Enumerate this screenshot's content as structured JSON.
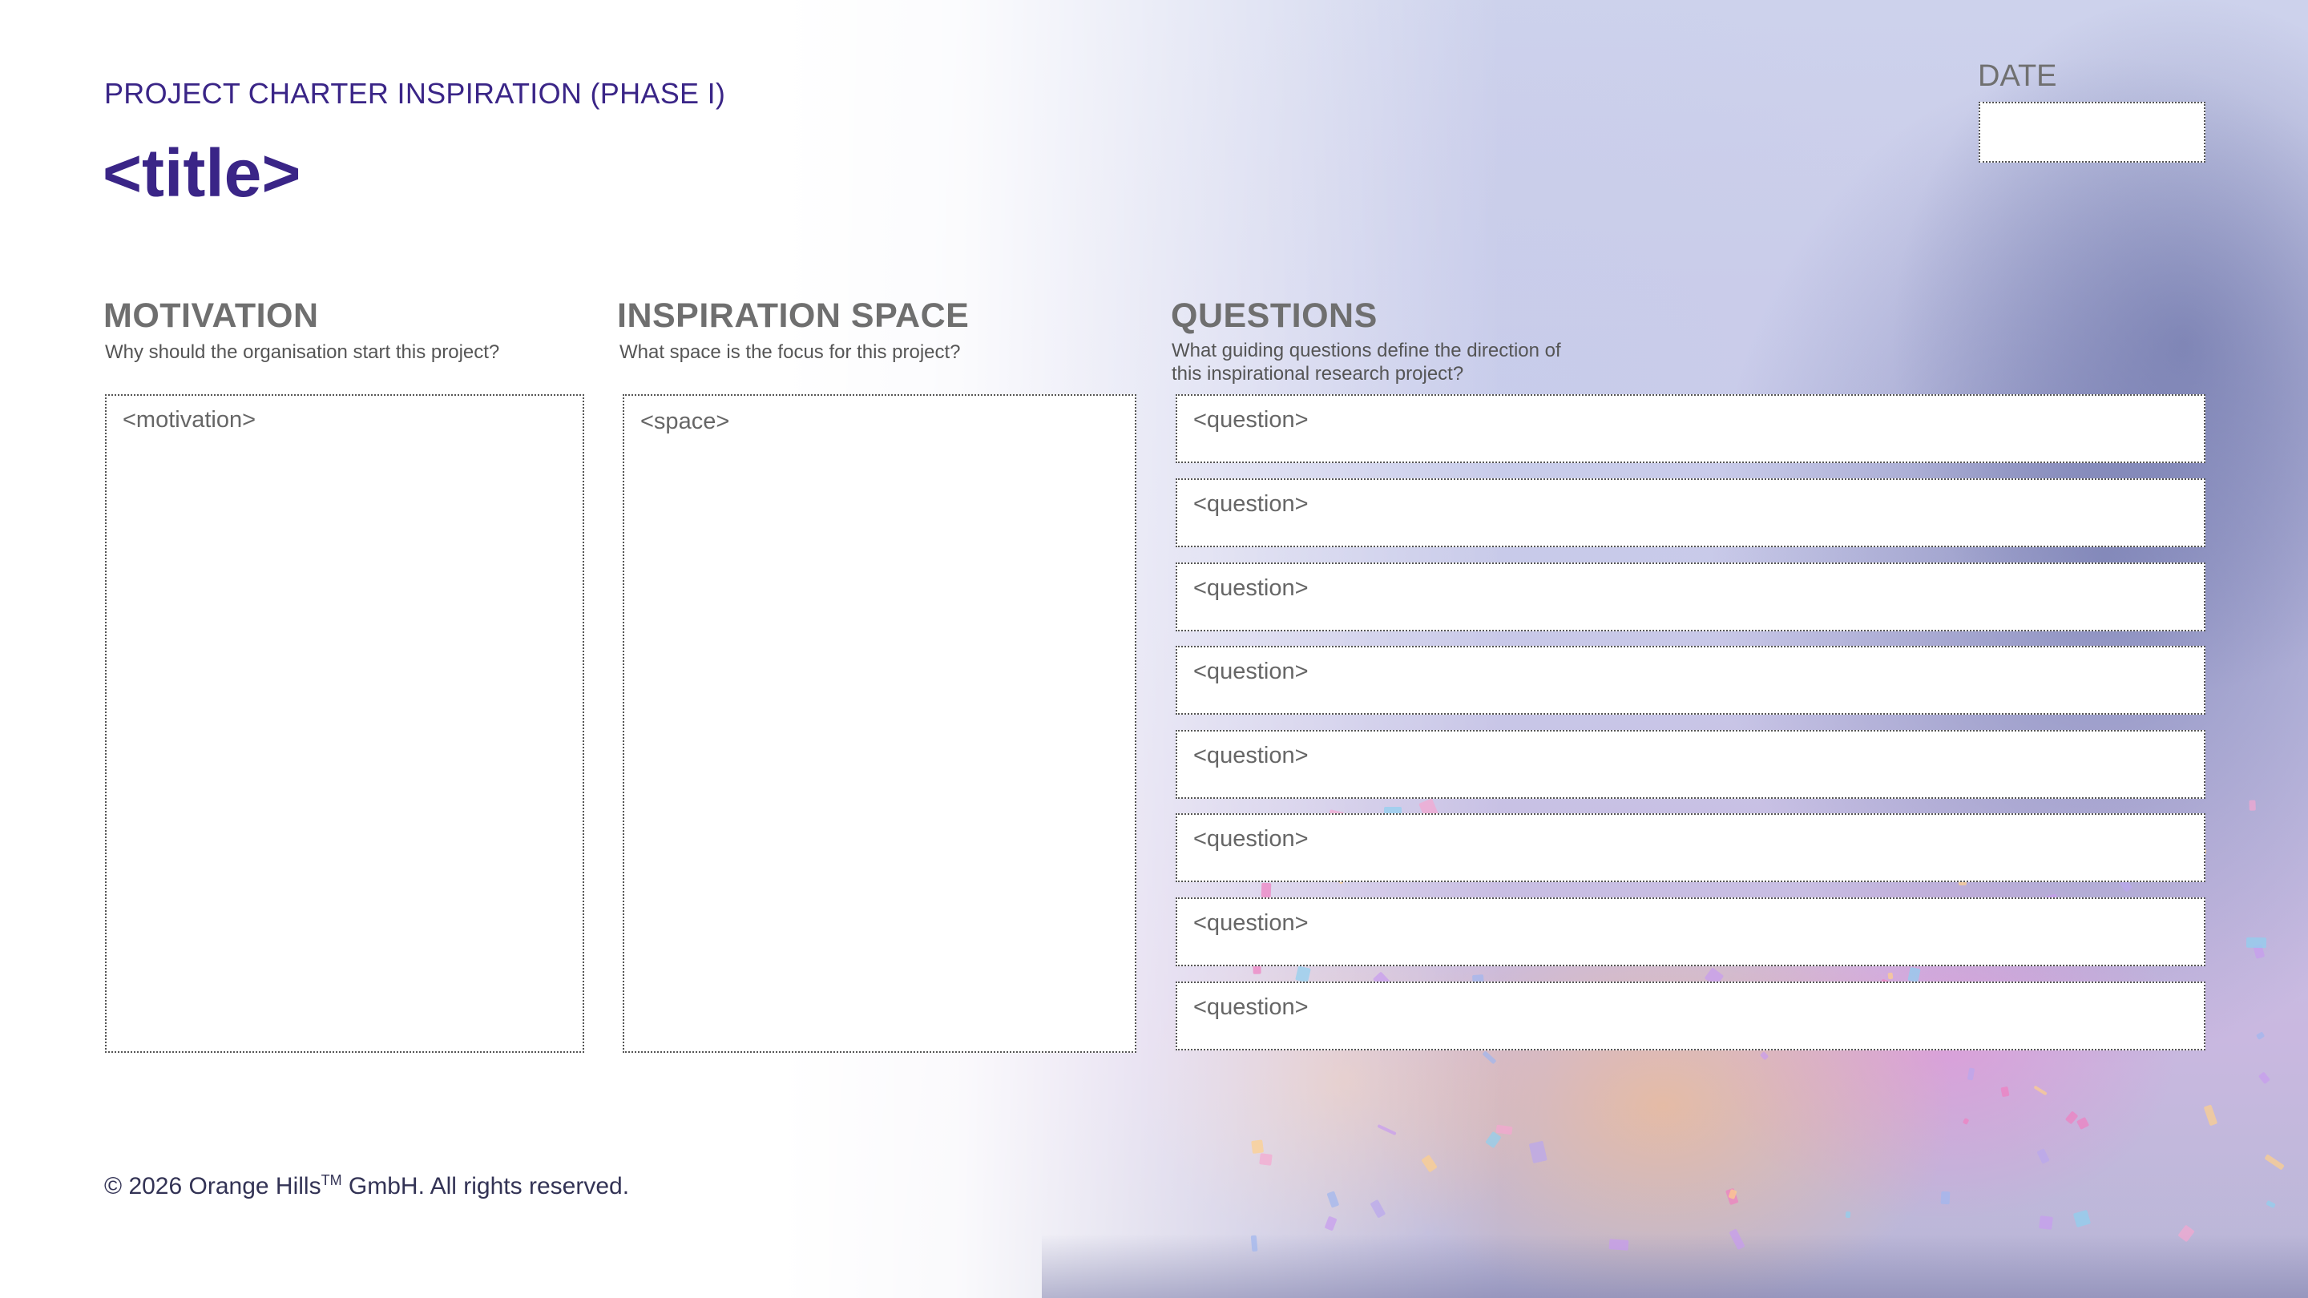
{
  "header": {
    "subtitle": "PROJECT CHARTER INSPIRATION (PHASE I)",
    "title": "<title>",
    "date_label": "DATE",
    "date_value": ""
  },
  "columns": {
    "motivation": {
      "heading": "MOTIVATION",
      "prompt": "Why should the organisation start this project?",
      "placeholder": "<motivation>"
    },
    "space": {
      "heading": "INSPIRATION SPACE",
      "prompt": "What space is the focus for this project?",
      "placeholder": "<space>"
    },
    "questions": {
      "heading": "QUESTIONS",
      "prompt_line1": "What guiding questions define the direction of",
      "prompt_line2": "this inspirational research project?",
      "items": [
        "<question>",
        "<question>",
        "<question>",
        "<question>",
        "<question>",
        "<question>",
        "<question>",
        "<question>"
      ]
    }
  },
  "footer": {
    "prefix": "© 2026 Orange Hills",
    "trademark": "TM",
    "suffix": " GmbH. All rights reserved."
  },
  "colors": {
    "brand_purple": "#3a2587",
    "heading_gray": "#6f6f6f"
  }
}
